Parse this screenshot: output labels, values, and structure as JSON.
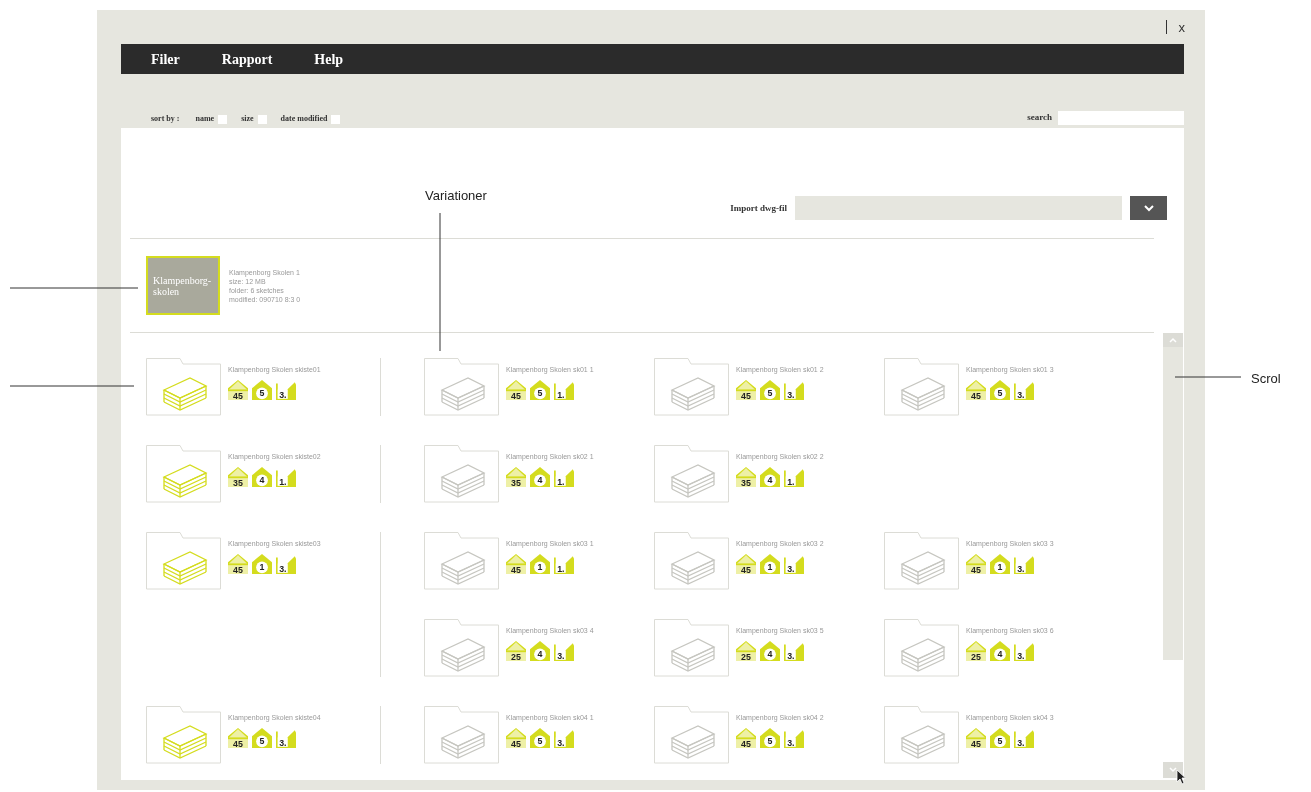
{
  "window": {
    "close": "x"
  },
  "menu": [
    "Filer",
    "Rapport",
    "Help"
  ],
  "sort": {
    "label": "sort by :",
    "options": [
      {
        "label": "name",
        "checked": false
      },
      {
        "label": "size",
        "checked": false
      },
      {
        "label": "date modified",
        "checked": false
      }
    ]
  },
  "search": {
    "label": "search"
  },
  "import": {
    "label": "Import dwg-fil"
  },
  "folder": {
    "name": "Klampenborg-skolen",
    "selected": true,
    "info": [
      "Klampenborg Skolen  1",
      "size: 12 MB",
      "folder: 6 sketches",
      "modified: 090710 8:3 0"
    ]
  },
  "rows": [
    {
      "sketch": {
        "title": "Klampenborg Skolen skiste01",
        "badges": [
          {
            "kind": "area",
            "text": "45"
          },
          {
            "kind": "count",
            "text": "5"
          },
          {
            "kind": "floors",
            "text": "3."
          }
        ]
      },
      "variation_lines": [
        [
          {
            "title": "Klampenborg Skolen sk01  1",
            "badges": [
              {
                "kind": "area",
                "text": "45"
              },
              {
                "kind": "count",
                "text": "5"
              },
              {
                "kind": "floors",
                "text": "1."
              }
            ]
          },
          {
            "title": "Klampenborg Skolen sk01  2",
            "badges": [
              {
                "kind": "area",
                "text": "45"
              },
              {
                "kind": "count",
                "text": "5"
              },
              {
                "kind": "floors",
                "text": "3."
              }
            ]
          },
          {
            "title": "Klampenborg Skolen sk01  3",
            "badges": [
              {
                "kind": "area",
                "text": "45"
              },
              {
                "kind": "count",
                "text": "5"
              },
              {
                "kind": "floors",
                "text": "3."
              }
            ]
          }
        ]
      ]
    },
    {
      "sketch": {
        "title": "Klampenborg Skolen skiste02",
        "badges": [
          {
            "kind": "area",
            "text": "35"
          },
          {
            "kind": "count",
            "text": "4"
          },
          {
            "kind": "floors",
            "text": "1."
          }
        ]
      },
      "variation_lines": [
        [
          {
            "title": "Klampenborg Skolen sk02  1",
            "badges": [
              {
                "kind": "area",
                "text": "35"
              },
              {
                "kind": "count",
                "text": "4"
              },
              {
                "kind": "floors",
                "text": "1."
              }
            ]
          },
          {
            "title": "Klampenborg Skolen sk02  2",
            "badges": [
              {
                "kind": "area",
                "text": "35"
              },
              {
                "kind": "count",
                "text": "4"
              },
              {
                "kind": "floors",
                "text": "1."
              }
            ]
          }
        ]
      ]
    },
    {
      "sketch": {
        "title": "Klampenborg Skolen skiste03",
        "badges": [
          {
            "kind": "area",
            "text": "45"
          },
          {
            "kind": "count",
            "text": "1"
          },
          {
            "kind": "floors",
            "text": "3."
          }
        ]
      },
      "variation_lines": [
        [
          {
            "title": "Klampenborg Skolen sk03  1",
            "badges": [
              {
                "kind": "area",
                "text": "45"
              },
              {
                "kind": "count",
                "text": "1"
              },
              {
                "kind": "floors",
                "text": "1."
              }
            ]
          },
          {
            "title": "Klampenborg Skolen sk03  2",
            "badges": [
              {
                "kind": "area",
                "text": "45"
              },
              {
                "kind": "count",
                "text": "1"
              },
              {
                "kind": "floors",
                "text": "3."
              }
            ]
          },
          {
            "title": "Klampenborg Skolen sk03 3",
            "badges": [
              {
                "kind": "area",
                "text": "45"
              },
              {
                "kind": "count",
                "text": "1"
              },
              {
                "kind": "floors",
                "text": "3."
              }
            ]
          }
        ],
        [
          {
            "title": "Klampenborg Skolen sk03 4",
            "badges": [
              {
                "kind": "area",
                "text": "25"
              },
              {
                "kind": "count",
                "text": "4"
              },
              {
                "kind": "floors",
                "text": "3."
              }
            ]
          },
          {
            "title": "Klampenborg Skolen sk03  5",
            "badges": [
              {
                "kind": "area",
                "text": "25"
              },
              {
                "kind": "count",
                "text": "4"
              },
              {
                "kind": "floors",
                "text": "3."
              }
            ]
          },
          {
            "title": "Klampenborg Skolen sk03 6",
            "badges": [
              {
                "kind": "area",
                "text": "25"
              },
              {
                "kind": "count",
                "text": "4"
              },
              {
                "kind": "floors",
                "text": "3."
              }
            ]
          }
        ]
      ]
    },
    {
      "sketch": {
        "title": "Klampenborg Skolen skiste04",
        "badges": [
          {
            "kind": "area",
            "text": "45"
          },
          {
            "kind": "count",
            "text": "5"
          },
          {
            "kind": "floors",
            "text": "3."
          }
        ]
      },
      "variation_lines": [
        [
          {
            "title": "Klampenborg Skolen sk04 1",
            "badges": [
              {
                "kind": "area",
                "text": "45"
              },
              {
                "kind": "count",
                "text": "5"
              },
              {
                "kind": "floors",
                "text": "3."
              }
            ]
          },
          {
            "title": "Klampenborg Skolen sk04 2",
            "badges": [
              {
                "kind": "area",
                "text": "45"
              },
              {
                "kind": "count",
                "text": "5"
              },
              {
                "kind": "floors",
                "text": "3."
              }
            ]
          },
          {
            "title": "Klampenborg Skolen sk04  3",
            "badges": [
              {
                "kind": "area",
                "text": "45"
              },
              {
                "kind": "count",
                "text": "5"
              },
              {
                "kind": "floors",
                "text": "3."
              }
            ]
          }
        ]
      ]
    }
  ],
  "annotations": [
    "Variationer",
    "Scrol"
  ]
}
